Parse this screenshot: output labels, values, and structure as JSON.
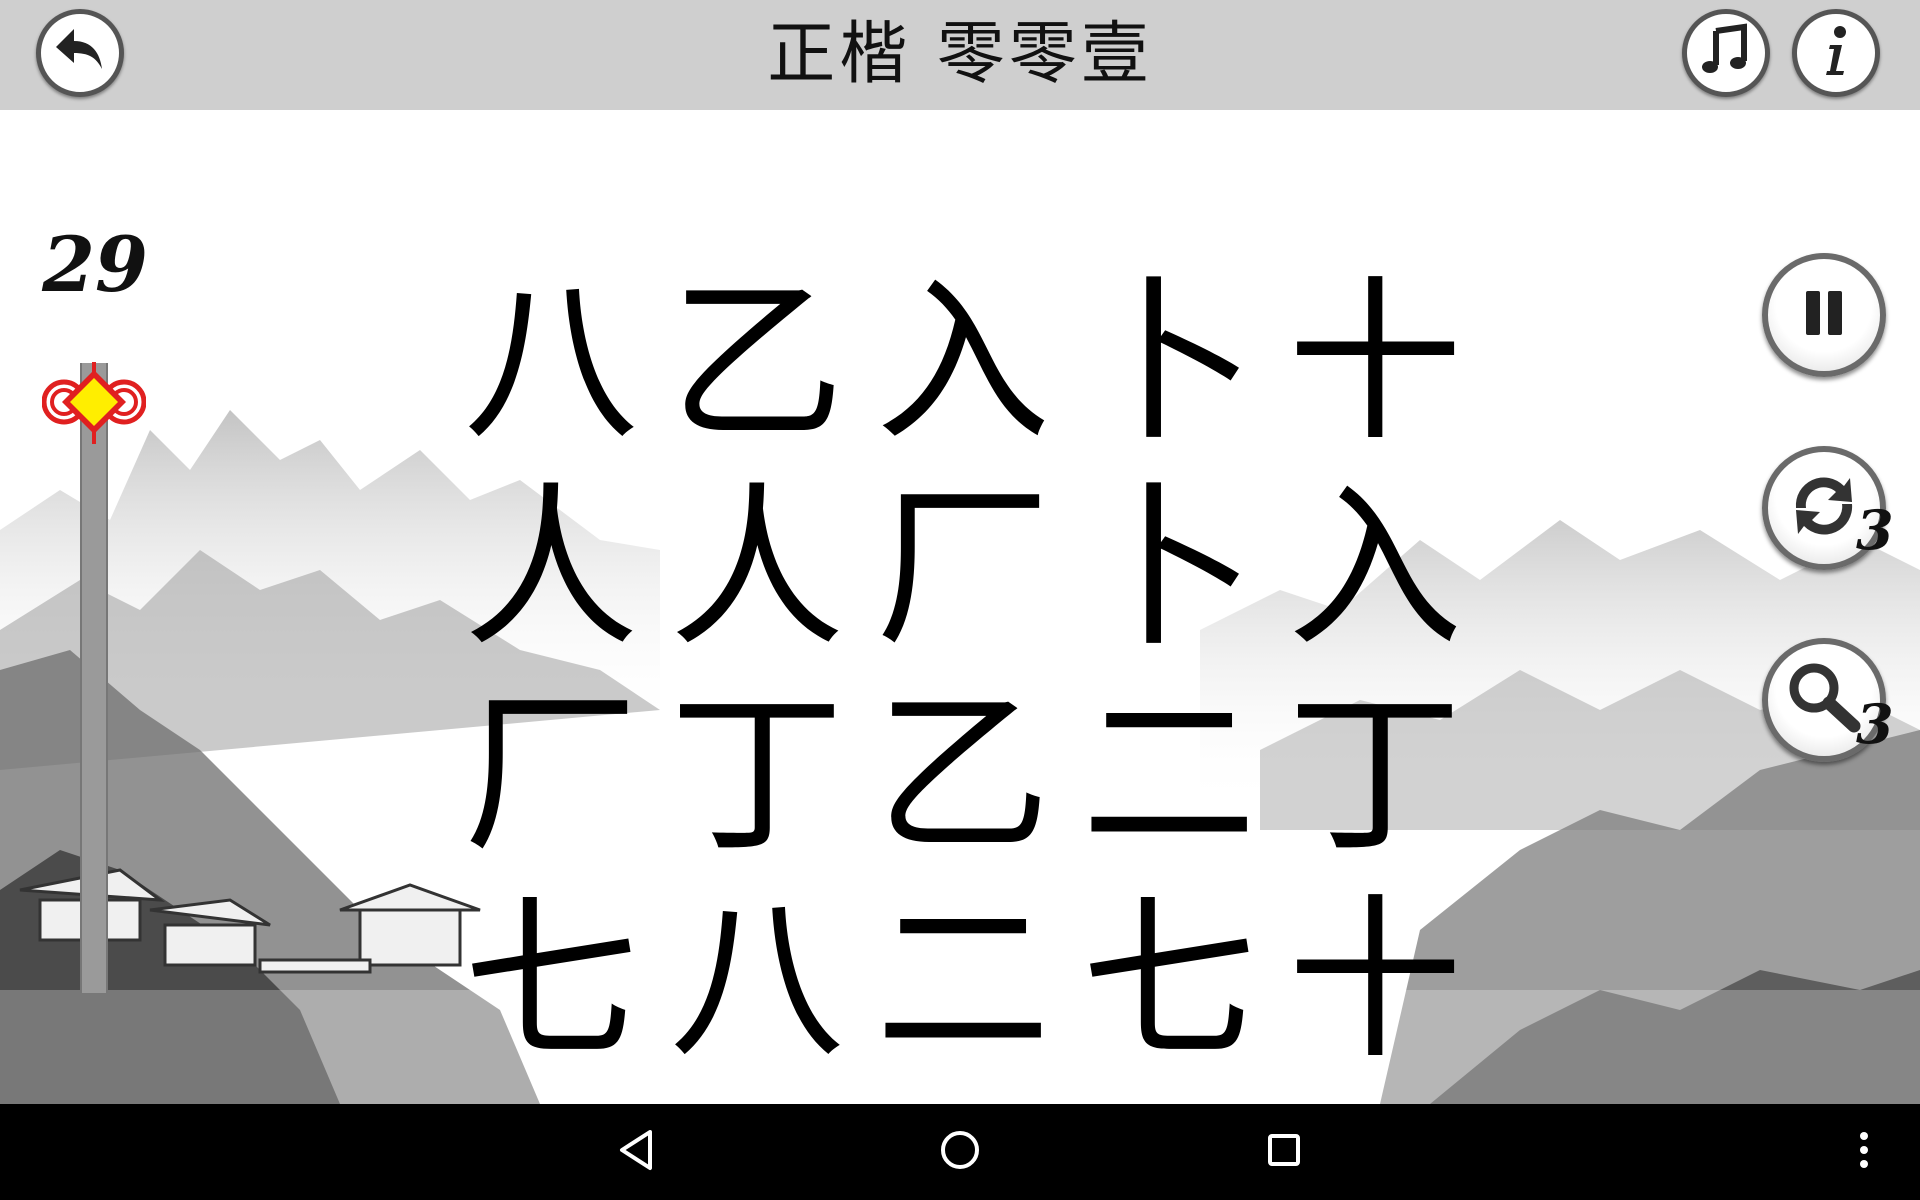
{
  "header": {
    "title": "正楷 零零壹"
  },
  "game": {
    "counter": "29",
    "grid": [
      [
        "八",
        "乙",
        "入",
        "卜",
        "十"
      ],
      [
        "人",
        "人",
        "厂",
        "卜",
        "入"
      ],
      [
        "厂",
        "丁",
        "乙",
        "二",
        "丁"
      ],
      [
        "七",
        "八",
        "二",
        "七",
        "十"
      ]
    ],
    "swap_count": "3",
    "hint_count": "3"
  },
  "icons": {
    "back": "back-arrow-icon",
    "music": "music-note-icon",
    "info": "info-icon",
    "pause": "pause-icon",
    "swap": "refresh-icon",
    "hint": "magnifier-icon",
    "timer_marker": "chinese-knot-icon"
  },
  "colors": {
    "topbar": "#cfcfcf",
    "knot_red": "#e02020",
    "knot_yellow": "#ffee00",
    "timer_bar": "#9a9a9a"
  }
}
